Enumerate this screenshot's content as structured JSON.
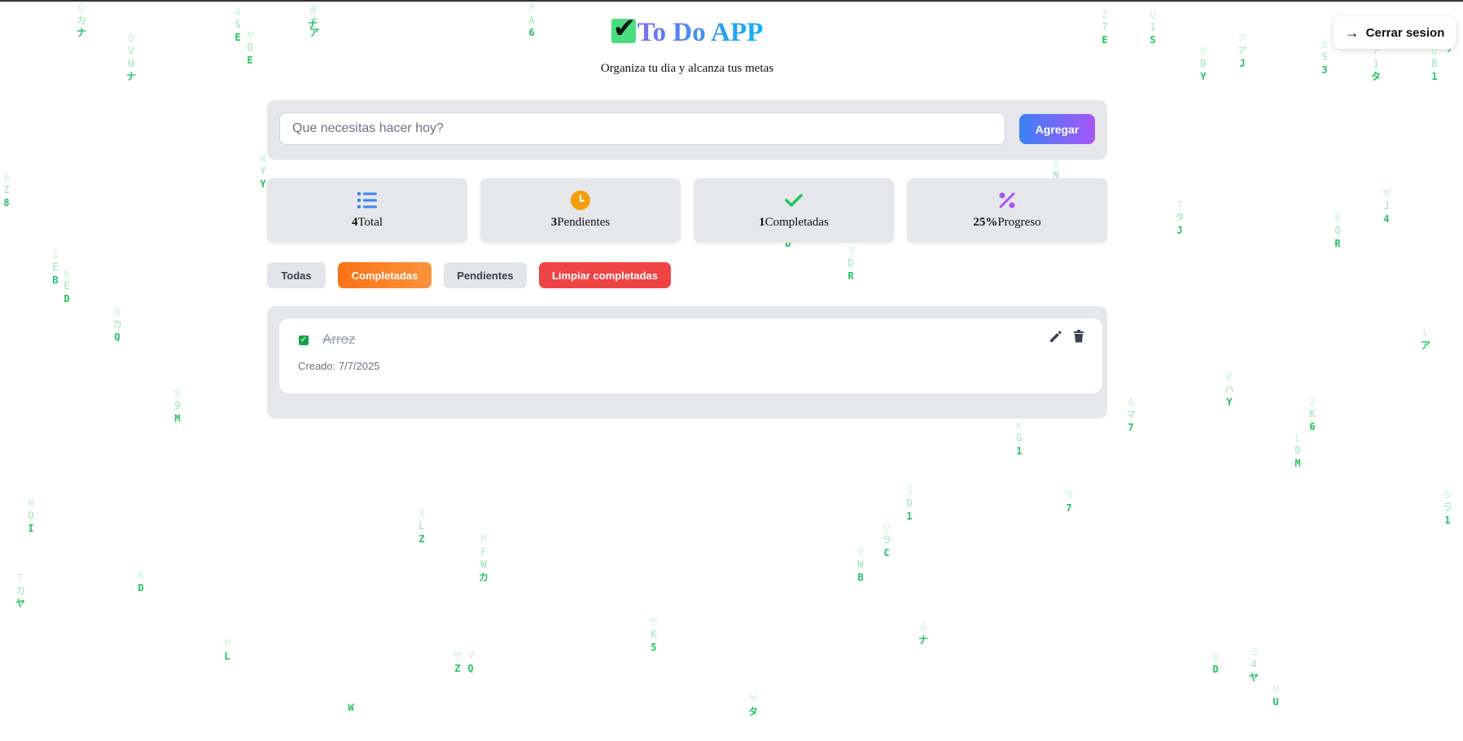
{
  "header": {
    "title": "To Do APP",
    "subtitle": "Organiza tu dia y alcanza tus metas",
    "logout_label": "Cerrar sesion",
    "logo_icon": "checkbox-icon"
  },
  "input": {
    "placeholder": "Que necesitas hacer hoy?",
    "value": "",
    "add_label": "Agregar"
  },
  "stats": [
    {
      "value": "4",
      "label": "Total",
      "icon": "list-icon",
      "color": "#3b82f6"
    },
    {
      "value": "3",
      "label": "Pendientes",
      "icon": "clock-icon",
      "color": "#f59e0b"
    },
    {
      "value": "1",
      "label": "Completadas",
      "icon": "check-icon",
      "color": "#22c55e"
    },
    {
      "value": "25%",
      "label": "Progreso",
      "icon": "percent-icon",
      "color": "#a855f7"
    }
  ],
  "filters": {
    "all": "Todas",
    "completed": "Completadas",
    "pending": "Pendientes",
    "clear": "Limpiar completadas",
    "active": "completed"
  },
  "tasks": [
    {
      "text": "Arroz",
      "created": "Creado: 7/7/2025",
      "completed": true
    }
  ],
  "colors": {
    "accent_blue": "#3b82f6",
    "accent_purple": "#a855f7",
    "orange": "#f97316",
    "red": "#ef4444",
    "matrix_green": "#22c55e"
  },
  "background": {
    "matrix_columns": [
      {
        "chars": [
          "D",
          "カ",
          "ナ"
        ]
      },
      {
        "chars": [
          "U",
          "ナ"
        ]
      },
      {
        "chars": [
          "Q",
          "V",
          "U",
          "ナ"
        ]
      },
      {
        "chars": [
          "4",
          "S",
          "E"
        ]
      },
      {
        "chars": [
          "ヤ",
          "Q",
          "E"
        ]
      },
      {
        "chars": [
          "U",
          "ナ",
          "ア"
        ]
      },
      {
        "chars": [
          "P",
          "A",
          "6"
        ]
      },
      {
        "chars": [
          "Z",
          "7",
          "E"
        ]
      },
      {
        "chars": [
          "U",
          "1",
          "S"
        ]
      },
      {
        "chars": [
          "O",
          "D",
          "Y"
        ]
      },
      {
        "chars": [
          "ア",
          "ア",
          "J"
        ]
      },
      {
        "chars": [
          "U",
          "S",
          "3"
        ]
      },
      {
        "chars": [
          "ア",
          "1",
          "タ"
        ]
      },
      {
        "chars": [
          "O",
          "B",
          "1"
        ]
      },
      {
        "chars": [
          "サ"
        ]
      },
      {
        "chars": [
          "Q",
          "ア"
        ]
      },
      {
        "chars": [
          "Y",
          "ミ"
        ]
      },
      {
        "chars": [
          "X",
          "P"
        ]
      },
      {
        "chars": [
          "W",
          "Y",
          "Y"
        ]
      },
      {
        "chars": [
          "6",
          "Z",
          "8"
        ]
      },
      {
        "chars": [
          "S",
          "E",
          "B"
        ]
      },
      {
        "chars": [
          "6",
          "E",
          "D"
        ]
      },
      {
        "chars": [
          "G",
          "カ",
          "Q"
        ]
      },
      {
        "chars": [
          "C",
          "2"
        ]
      },
      {
        "chars": [
          "B",
          "ラ",
          "D"
        ]
      },
      {
        "chars": [
          "ヲ",
          "D",
          "R"
        ]
      },
      {
        "chars": [
          "L",
          "シ"
        ]
      },
      {
        "chars": [
          "V",
          "N",
          "6"
        ]
      },
      {
        "chars": [
          "ナ",
          "A"
        ]
      },
      {
        "chars": [
          "T",
          "タ",
          "J"
        ]
      },
      {
        "chars": [
          "サ",
          "J",
          "4"
        ]
      },
      {
        "chars": [
          "B",
          "Q",
          "R"
        ]
      },
      {
        "chars": [
          "S",
          "9",
          "M"
        ]
      },
      {
        "chars": [
          "ア",
          "X"
        ]
      },
      {
        "chars": [
          "5",
          "タ"
        ]
      },
      {
        "chars": [
          "Y"
        ]
      },
      {
        "chars": [
          "K",
          "G",
          "1"
        ]
      },
      {
        "chars": [
          "P",
          "ハ",
          "Y"
        ]
      },
      {
        "chars": [
          "A",
          "マ",
          "7"
        ]
      },
      {
        "chars": [
          "2",
          "K",
          "6"
        ]
      },
      {
        "chars": [
          "L",
          "D",
          "M"
        ]
      },
      {
        "chars": [
          "L",
          "ア"
        ]
      },
      {
        "chars": [
          "ラ",
          "7"
        ]
      },
      {
        "chars": [
          "N",
          "O",
          "I"
        ]
      },
      {
        "chars": [
          "T",
          "カ",
          "ヤ"
        ]
      },
      {
        "chars": [
          "A",
          "D"
        ]
      },
      {
        "chars": [
          "X",
          "L",
          "Z"
        ]
      },
      {
        "chars": [
          "M",
          "F",
          "W",
          "カ"
        ]
      },
      {
        "chars": [
          "3",
          "D",
          "1"
        ]
      },
      {
        "chars": [
          "U",
          "ラ",
          "C"
        ]
      },
      {
        "chars": [
          "V",
          "W",
          "B"
        ]
      },
      {
        "chars": [
          "タ",
          "ラ",
          "1"
        ]
      },
      {
        "chars": [
          "ヤ",
          "L"
        ]
      },
      {
        "chars": [
          "サ",
          "Z"
        ]
      },
      {
        "chars": [
          "マ",
          "Q"
        ]
      },
      {
        "chars": [
          "ケ",
          "K",
          "5"
        ]
      },
      {
        "chars": [
          "G",
          "ナ"
        ]
      },
      {
        "chars": [
          "G",
          "D"
        ]
      },
      {
        "chars": [
          "ラ",
          "4",
          "ヤ"
        ]
      },
      {
        "chars": [
          "H",
          "U"
        ]
      },
      {
        "chars": [
          "W"
        ]
      },
      {
        "chars": [
          "ヤ",
          "タ"
        ]
      },
      {
        "chars": [
          "Q"
        ]
      },
      {
        "chars": [
          "ア"
        ]
      },
      {
        "chars": [
          "H",
          "M",
          "G"
        ]
      }
    ]
  }
}
